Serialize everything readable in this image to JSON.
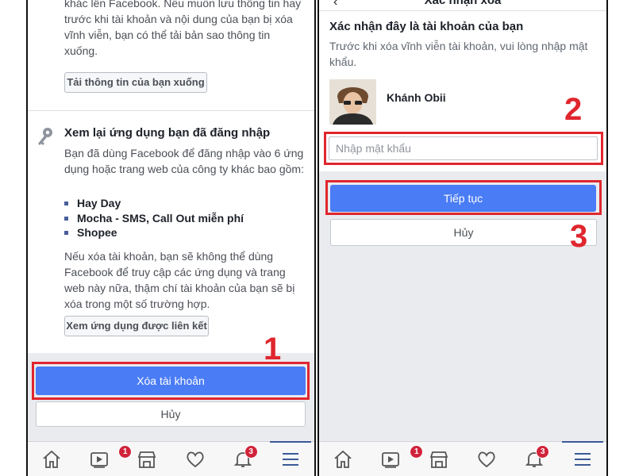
{
  "left": {
    "download_text": "khác lên Facebook. Nếu muốn lưu thông tin hay trước khi tài khoản và nội dung của bạn bị xóa vĩnh viễn, bạn có thể tải bản sao thông tin xuống.",
    "download_button": "Tải thông tin của bạn xuống",
    "apps_title": "Xem lại ứng dụng bạn đã đăng nhập",
    "apps_desc": "Bạn đã dùng Facebook để đăng nhập vào 6 ứng dụng hoặc trang web của công ty khác bao gồm:",
    "apps": [
      "Hay Day",
      "Mocha - SMS, Call Out miễn phí",
      "Shopee"
    ],
    "warn_desc": "Nếu xóa tài khoản, bạn sẽ không thể dùng Facebook để truy cập các ứng dụng và trang web này nữa, thậm chí tài khoản của bạn sẽ bị xóa trong một số trường hợp.",
    "linked_apps_button": "Xem ứng dụng được liên kết",
    "delete_button": "Xóa tài khoản",
    "cancel_button": "Hủy",
    "step_label": "1"
  },
  "right": {
    "header_title": "Xác nhận xóa",
    "confirm_title": "Xác nhận đây là tài khoản của bạn",
    "confirm_desc": "Trước khi xóa vĩnh viễn tài khoản, vui lòng nhập mật khẩu.",
    "user_name": "Khánh Obii",
    "password_placeholder": "Nhập mật khẩu",
    "continue_button": "Tiếp tục",
    "cancel_button": "Hủy",
    "step2_label": "2",
    "step3_label": "3"
  },
  "tabbar": {
    "video_badge": "1",
    "notifications_badge": "3",
    "icons": [
      "home-icon",
      "video-icon",
      "marketplace-icon",
      "dating-heart-icon",
      "notifications-bell-icon",
      "menu-icon"
    ]
  },
  "colors": {
    "primary": "#4a7cf5",
    "highlight": "#e0262e",
    "badge": "#d0243b",
    "background_band": "#e9ebee"
  }
}
